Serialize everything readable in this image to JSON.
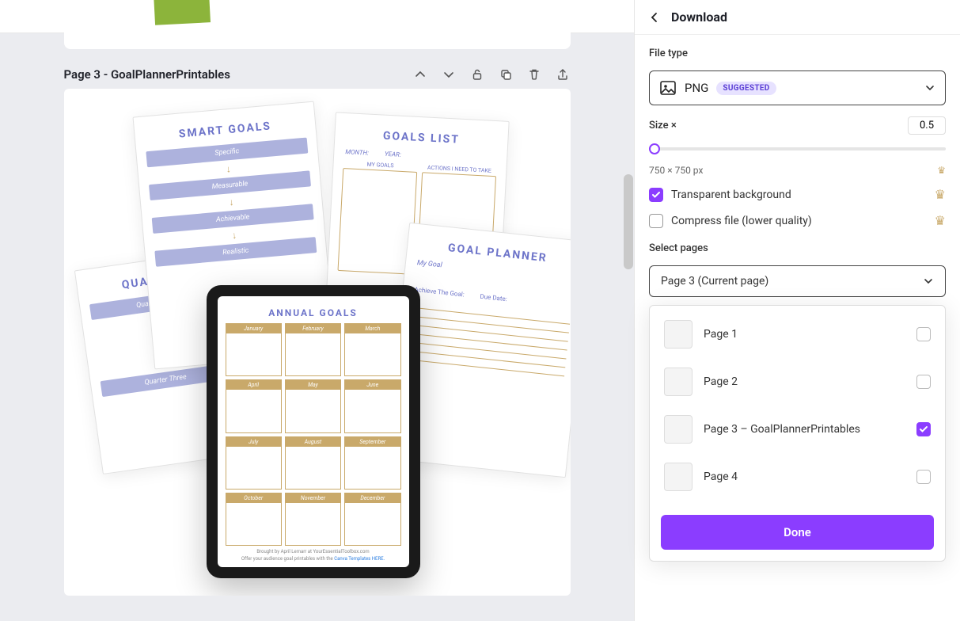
{
  "sidebar": {
    "title": "Download",
    "filetype_label": "File type",
    "filetype_value": "PNG",
    "filetype_badge": "SUGGESTED",
    "size_label": "Size ×",
    "size_value": "0.5",
    "dimensions": "750 × 750 px",
    "opt_transparent": "Transparent background",
    "opt_compress": "Compress file (lower quality)",
    "select_pages_label": "Select pages",
    "select_pages_value": "Page 3 (Current page)",
    "done_label": "Done",
    "pages": [
      {
        "label": "Page 1",
        "checked": false
      },
      {
        "label": "Page 2",
        "checked": false
      },
      {
        "label": "Page 3 – GoalPlannerPrintables",
        "checked": true
      },
      {
        "label": "Page 4",
        "checked": false
      }
    ]
  },
  "canvas": {
    "page_title": "Page 3 - GoalPlannerPrintables",
    "sheets": {
      "smart_goals": {
        "title": "SMART GOALS",
        "rows": [
          "Specific",
          "Measurable",
          "Achievable",
          "Realistic"
        ]
      },
      "goals_list": {
        "title": "GOALS LIST",
        "sub": [
          "MONTH:",
          "YEAR:"
        ],
        "cols": [
          "MY GOALS",
          "ACTIONS I NEED TO TAKE"
        ]
      },
      "quarter": {
        "title": "QUARTER",
        "sections": [
          "Quarter One",
          "Quarter Three"
        ]
      },
      "planner": {
        "title": "GOAL PLANNER",
        "sub": "My Goal",
        "achieve": "Achieve The Goal:",
        "due": "Due Date:"
      }
    },
    "ipad": {
      "title": "ANNUAL GOALS",
      "months": [
        "January",
        "February",
        "March",
        "April",
        "May",
        "June",
        "July",
        "August",
        "September",
        "October",
        "November",
        "December"
      ],
      "footer1": "Brought by April Lemarr at YourEssentialToolbox.com",
      "footer2": "Offer your audience goal printables with the ",
      "footer2_link": "Canva Templates HERE."
    }
  }
}
